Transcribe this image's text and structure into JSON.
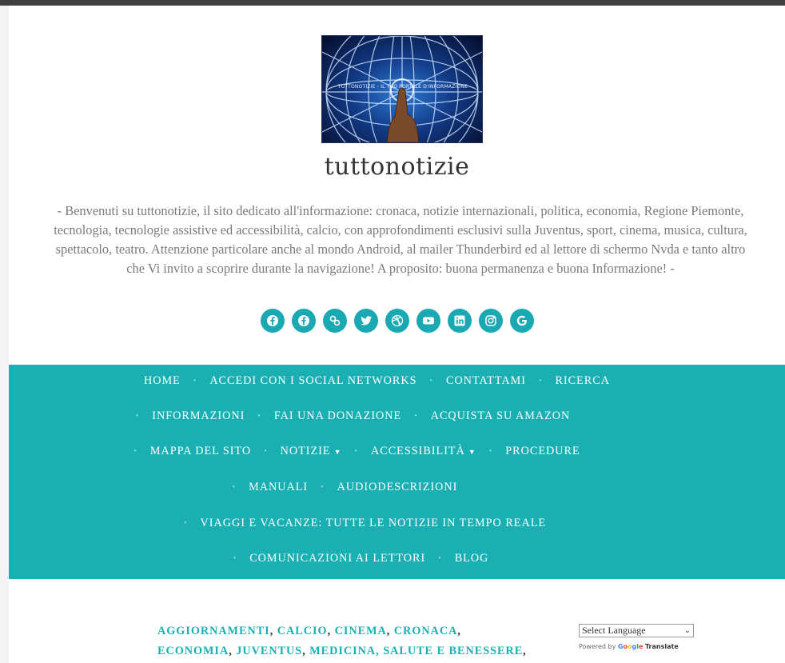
{
  "site": {
    "logo_caption": "TUTTONOTIZIE - IL TUO PORTALE D'INFORMAZIONE",
    "title": "tuttonotizie",
    "tagline": "- Benvenuti su tuttonotizie, il sito dedicato all'informazione: cronaca, notizie internazionali, politica, economia, Regione Piemonte, tecnologia, tecnologie assistive ed accessibilità, calcio, con approfondimenti esclusivi sulla Juventus, sport, cinema, musica, cultura, spettacolo, teatro. Attenzione particolare anche al mondo Android, al mailer Thunderbird ed al lettore di schermo Nvda e tanto altro che Vi invito a scoprire durante la navigazione! A proposito: buona permanenza e buona Informazione! -"
  },
  "social": [
    {
      "icon": "facebook-icon"
    },
    {
      "icon": "facebook-group-icon"
    },
    {
      "icon": "link-icon"
    },
    {
      "icon": "twitter-icon"
    },
    {
      "icon": "dribbble-icon"
    },
    {
      "icon": "youtube-icon"
    },
    {
      "icon": "linkedin-icon"
    },
    {
      "icon": "instagram-icon"
    },
    {
      "icon": "google-icon"
    }
  ],
  "nav": {
    "home": "HOME",
    "accedi": "ACCEDI CON I SOCIAL NETWORKS",
    "contattami": "CONTATTAMI",
    "ricerca": "RICERCA",
    "informazioni": "INFORMAZIONI",
    "donazione": "FAI UNA DONAZIONE",
    "amazon": "ACQUISTA SU AMAZON",
    "mappa": "MAPPA DEL SITO",
    "notizie": "NOTIZIE",
    "accessibilita": "ACCESSIBILITÀ",
    "procedure": "PROCEDURE",
    "manuali": "MANUALI",
    "audiodescrizioni": "AUDIODESCRIZIONI",
    "viaggi": "VIAGGI E VACANZE: TUTTE LE NOTIZIE IN TEMPO REALE",
    "comunicazioni": "COMUNICAZIONI AI LETTORI",
    "blog": "BLOG"
  },
  "categories": {
    "aggiornamenti": "AGGIORNAMENTI",
    "calcio": "CALCIO",
    "cinema": "CINEMA",
    "cronaca": "CRONACA",
    "economia": "ECONOMIA",
    "juventus": "JUVENTUS",
    "medicina": "MEDICINA, SALUTE E BENESSERE"
  },
  "translate": {
    "select_label": "Select Language",
    "powered_by": "Powered by",
    "google": "Google",
    "translate": "Translate"
  },
  "colors": {
    "accent": "#1ab0b3",
    "social_button": "#1aa9b2",
    "topbar": "#3f3f3f"
  }
}
